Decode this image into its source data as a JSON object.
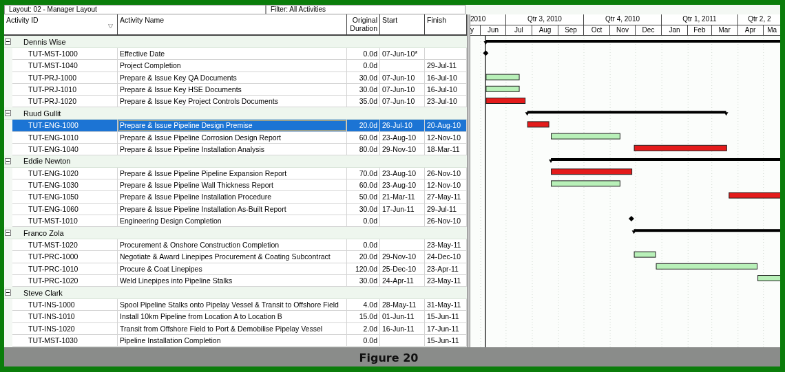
{
  "toolbar": {
    "layout": "Layout: 02 - Manager Layout",
    "filter": "Filter: All Activities"
  },
  "columns": [
    "Activity ID",
    "Activity Name",
    "Original Duration",
    "Start",
    "Finish"
  ],
  "timescale": {
    "quarters": [
      "2010",
      "Qtr 3, 2010",
      "Qtr 4, 2010",
      "Qtr 1, 2011",
      "Qtr 2, 2"
    ],
    "months": [
      "y",
      "Jun",
      "Jul",
      "Aug",
      "Sep",
      "Oct",
      "Nov",
      "Dec",
      "Jan",
      "Feb",
      "Mar",
      "Apr",
      "Ma"
    ]
  },
  "groups": [
    {
      "name": "Dennis Wise",
      "expanded": true,
      "activities": [
        {
          "id": "TUT-MST-1000",
          "name": "Effective Date",
          "duration": "0.0d",
          "start": "07-Jun-10*",
          "kind": "milestone",
          "selected": false
        },
        {
          "id": "TUT-MST-1040",
          "name": "Project Completion",
          "duration": "0.0d",
          "finish": "29-Jul-11",
          "kind": "milestone",
          "selected": false
        },
        {
          "id": "TUT-PRJ-1000",
          "name": "Prepare & Issue Key QA Documents",
          "duration": "30.0d",
          "start": "07-Jun-10",
          "finish": "16-Jul-10",
          "kind": "task",
          "color": "#b8f0b8",
          "selected": false
        },
        {
          "id": "TUT-PRJ-1010",
          "name": "Prepare & Issue Key HSE Documents",
          "duration": "30.0d",
          "start": "07-Jun-10",
          "finish": "16-Jul-10",
          "kind": "task",
          "color": "#b8f0b8",
          "selected": false
        },
        {
          "id": "TUT-PRJ-1020",
          "name": "Prepare & Issue Key Project Controls Documents",
          "duration": "35.0d",
          "start": "07-Jun-10",
          "finish": "23-Jul-10",
          "kind": "task",
          "color": "#e41b1b",
          "selected": false
        }
      ]
    },
    {
      "name": "Ruud Gullit",
      "expanded": true,
      "activities": [
        {
          "id": "TUT-ENG-1000",
          "name": "Prepare & Issue Pipeline Design Premise",
          "duration": "20.0d",
          "start": "26-Jul-10",
          "finish": "20-Aug-10",
          "kind": "task",
          "color": "#e41b1b",
          "selected": true
        },
        {
          "id": "TUT-ENG-1010",
          "name": "Prepare & Issue Pipeline Corrosion Design Report",
          "duration": "60.0d",
          "start": "23-Aug-10",
          "finish": "12-Nov-10",
          "kind": "task",
          "color": "#b8f0b8",
          "selected": false
        },
        {
          "id": "TUT-ENG-1040",
          "name": "Prepare & Issue Pipeline Installation Analysis",
          "duration": "80.0d",
          "start": "29-Nov-10",
          "finish": "18-Mar-11",
          "kind": "task",
          "color": "#e41b1b",
          "selected": false
        }
      ]
    },
    {
      "name": "Eddie Newton",
      "expanded": true,
      "activities": [
        {
          "id": "TUT-ENG-1020",
          "name": "Prepare & Issue Pipeline Pipeline Expansion Report",
          "duration": "70.0d",
          "start": "23-Aug-10",
          "finish": "26-Nov-10",
          "kind": "task",
          "color": "#e41b1b",
          "selected": false
        },
        {
          "id": "TUT-ENG-1030",
          "name": "Prepare & Issue Pipeline Wall Thickness Report",
          "duration": "60.0d",
          "start": "23-Aug-10",
          "finish": "12-Nov-10",
          "kind": "task",
          "color": "#b8f0b8",
          "selected": false
        },
        {
          "id": "TUT-ENG-1050",
          "name": "Prepare & Issue Pipeline Installation Procedure",
          "duration": "50.0d",
          "start": "21-Mar-11",
          "finish": "27-May-11",
          "kind": "task",
          "color": "#e41b1b",
          "selected": false
        },
        {
          "id": "TUT-ENG-1060",
          "name": "Prepare & Issue Pipeline Installation As-Built Report",
          "duration": "30.0d",
          "start": "17-Jun-11",
          "finish": "29-Jul-11",
          "kind": "task",
          "selected": false
        },
        {
          "id": "TUT-MST-1010",
          "name": "Engineering Design Completion",
          "duration": "0.0d",
          "finish": "26-Nov-10",
          "kind": "milestone",
          "selected": false
        }
      ]
    },
    {
      "name": "Franco Zola",
      "expanded": true,
      "activities": [
        {
          "id": "TUT-MST-1020",
          "name": "Procurement & Onshore Construction Completion",
          "duration": "0.0d",
          "finish": "23-May-11",
          "kind": "milestone",
          "selected": false
        },
        {
          "id": "TUT-PRC-1000",
          "name": "Negotiate & Award Linepipes Procurement & Coating Subcontract",
          "duration": "20.0d",
          "start": "29-Nov-10",
          "finish": "24-Dec-10",
          "kind": "task",
          "color": "#b8f0b8",
          "selected": false
        },
        {
          "id": "TUT-PRC-1010",
          "name": "Procure & Coat Linepipes",
          "duration": "120.0d",
          "start": "25-Dec-10",
          "finish": "23-Apr-11",
          "kind": "task",
          "color": "#b8f0b8",
          "selected": false
        },
        {
          "id": "TUT-PRC-1020",
          "name": "Weld Linepipes into Pipeline Stalks",
          "duration": "30.0d",
          "start": "24-Apr-11",
          "finish": "23-May-11",
          "kind": "task",
          "color": "#b8f0b8",
          "selected": false
        }
      ]
    },
    {
      "name": "Steve Clark",
      "expanded": true,
      "activities": [
        {
          "id": "TUT-INS-1000",
          "name": "Spool Pipeline Stalks onto Pipelay Vessel & Transit to Offshore Field",
          "duration": "4.0d",
          "start": "28-May-11",
          "finish": "31-May-11",
          "kind": "task",
          "selected": false
        },
        {
          "id": "TUT-INS-1010",
          "name": "Install 10km Pipeline from Location A to Location B",
          "duration": "15.0d",
          "start": "01-Jun-11",
          "finish": "15-Jun-11",
          "kind": "task",
          "selected": false
        },
        {
          "id": "TUT-INS-1020",
          "name": "Transit from Offshore Field to Port & Demobilise Pipelay Vessel",
          "duration": "2.0d",
          "start": "16-Jun-11",
          "finish": "17-Jun-11",
          "kind": "task",
          "selected": false
        },
        {
          "id": "TUT-MST-1030",
          "name": "Pipeline Installation Completion",
          "duration": "0.0d",
          "finish": "15-Jun-11",
          "kind": "milestone",
          "selected": false
        }
      ]
    }
  ],
  "caption": "Figure 20"
}
